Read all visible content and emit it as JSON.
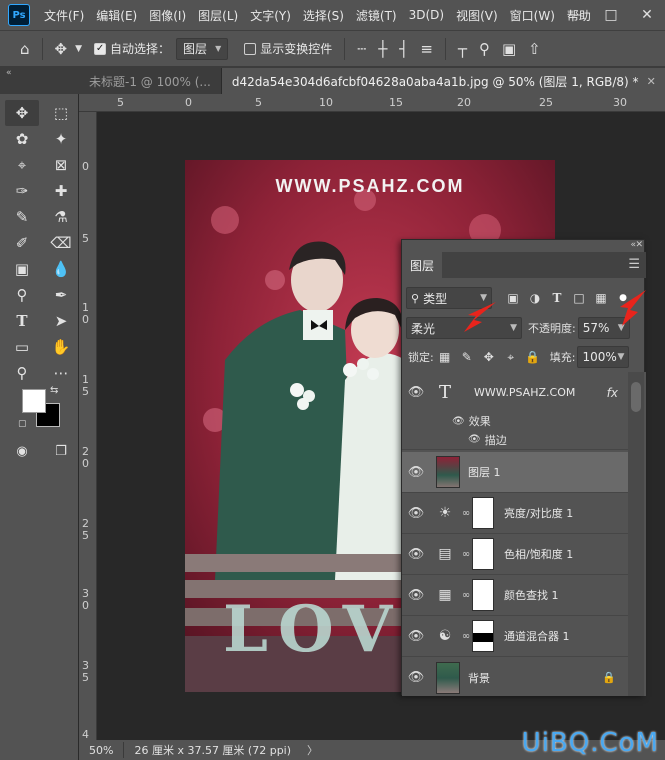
{
  "app": {
    "logo_text": "Ps"
  },
  "menu": [
    "文件(F)",
    "编辑(E)",
    "图像(I)",
    "图层(L)",
    "文字(Y)",
    "选择(S)",
    "滤镜(T)",
    "3D(D)",
    "视图(V)",
    "窗口(W)",
    "帮助"
  ],
  "options_bar": {
    "auto_select_label": "自动选择：",
    "auto_select_checked": true,
    "auto_select_target": "图层",
    "show_transform_label": "显示变换控件",
    "show_transform_checked": false
  },
  "tabs": [
    {
      "label": "未标题-1 @ 100% (...",
      "active": false
    },
    {
      "label": "d42da54e304d6afcbf04628a0aba4a1b.jpg @ 50% (图层 1, RGB/8) *",
      "active": true
    }
  ],
  "ruler_top": [
    "5",
    "0",
    "5",
    "10",
    "15",
    "20",
    "25",
    "30"
  ],
  "ruler_left": [
    "0",
    "5",
    "1 0",
    "1 5",
    "2 0",
    "2 5",
    "3 0",
    "3 5",
    "4"
  ],
  "photo": {
    "watermark_text": "WWW.PSAHZ.COM",
    "sign_letters": [
      "L",
      "O",
      "V"
    ]
  },
  "status": {
    "zoom": "50%",
    "doc_info": "26 厘米 x 37.57 厘米 (72 ppi)",
    "arrow": "〉"
  },
  "site_watermark": "UiBQ.CoM",
  "layers_panel": {
    "tab_label": "图层",
    "filter_kind": "类型",
    "blend_mode": "柔光",
    "opacity_label": "不透明度:",
    "opacity_value": "57%",
    "lock_label": "锁定:",
    "fill_label": "填充:",
    "fill_value": "100%",
    "layers": [
      {
        "name": "WWW.PSAHZ.COM",
        "kind": "text",
        "fx": "fx"
      },
      {
        "name": "图层 1",
        "kind": "pixel",
        "selected": true
      },
      {
        "name": "亮度/对比度 1",
        "kind": "adjustment",
        "icon": "brightness-contrast-icon"
      },
      {
        "name": "色相/饱和度 1",
        "kind": "adjustment",
        "icon": "hue-saturation-icon"
      },
      {
        "name": "颜色查找 1",
        "kind": "adjustment",
        "icon": "color-lookup-icon"
      },
      {
        "name": "通道混合器 1",
        "kind": "adjustment",
        "icon": "channel-mixer-icon"
      },
      {
        "name": "背景",
        "kind": "background",
        "locked": true
      }
    ],
    "effects": {
      "label": "效果",
      "stroke": "描边"
    }
  },
  "colors": {
    "accent_red": "#e8241c",
    "foreground": "#ffffff",
    "background": "#000000",
    "watermark_blue": "#4aa8f0"
  }
}
